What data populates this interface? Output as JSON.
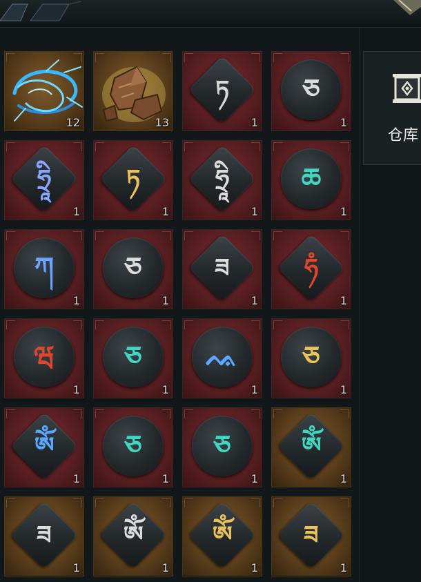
{
  "side_panel": {
    "label": "仓库",
    "icon": "storage-chest-icon"
  },
  "inventory": {
    "slots": [
      {
        "item": "lightning-essence-icon",
        "qty": "12",
        "frame": "gold",
        "kind": "illus"
      },
      {
        "item": "ore-rock-icon",
        "qty": "13",
        "frame": "gold",
        "kind": "illus"
      },
      {
        "item": "rune-diamond-icon",
        "glyph": "ཏ",
        "glyph_color": "#d8d8d8",
        "qty": "1",
        "frame": "red",
        "kind": "diamond"
      },
      {
        "item": "rune-circle-icon",
        "glyph": "ཅ",
        "glyph_color": "#dcdcdc",
        "qty": "1",
        "frame": "red",
        "kind": "circle"
      },
      {
        "item": "rune-diamond-icon",
        "glyph": "ཧྲཱི",
        "glyph_color": "#8aa6ff",
        "qty": "1",
        "frame": "red",
        "kind": "diamond"
      },
      {
        "item": "rune-diamond-icon",
        "glyph": "ཏ",
        "glyph_color": "#e8c25a",
        "qty": "1",
        "frame": "red",
        "kind": "diamond"
      },
      {
        "item": "rune-diamond-icon",
        "glyph": "ཧྲཱི",
        "glyph_color": "#dcdcdc",
        "qty": "1",
        "frame": "red",
        "kind": "diamond"
      },
      {
        "item": "rune-circle-icon",
        "glyph": "ཆ",
        "glyph_color": "#3fd6c2",
        "qty": "1",
        "frame": "red",
        "kind": "circle"
      },
      {
        "item": "rune-circle-icon",
        "glyph": "ཀ",
        "glyph_color": "#6aa6ff",
        "qty": "1",
        "frame": "red",
        "kind": "circle"
      },
      {
        "item": "rune-circle-icon",
        "glyph": "ཅ",
        "glyph_color": "#dcdcdc",
        "qty": "1",
        "frame": "red",
        "kind": "circle"
      },
      {
        "item": "rune-diamond-icon",
        "glyph": "ཟ",
        "glyph_color": "#dcdcdc",
        "qty": "1",
        "frame": "red",
        "kind": "diamond"
      },
      {
        "item": "rune-diamond-icon",
        "glyph": "ཧཾ",
        "glyph_color": "#e0452e",
        "qty": "1",
        "frame": "red",
        "kind": "diamond"
      },
      {
        "item": "rune-circle-icon",
        "glyph": "ཝ",
        "glyph_color": "#e0452e",
        "qty": "1",
        "frame": "red",
        "kind": "circle"
      },
      {
        "item": "rune-circle-icon",
        "glyph": "ཅ",
        "glyph_color": "#3fd6c2",
        "qty": "1",
        "frame": "red",
        "kind": "circle"
      },
      {
        "item": "rune-circle-icon",
        "glyph": "ᨕ",
        "glyph_color": "#5aa8ff",
        "qty": "1",
        "frame": "red",
        "kind": "circle"
      },
      {
        "item": "rune-circle-icon",
        "glyph": "ཅ",
        "glyph_color": "#e8c25a",
        "qty": "1",
        "frame": "red",
        "kind": "circle"
      },
      {
        "item": "rune-diamond-icon",
        "glyph": "ཨོཾ",
        "glyph_color": "#5aa8ff",
        "qty": "1",
        "frame": "red",
        "kind": "diamond"
      },
      {
        "item": "rune-circle-icon",
        "glyph": "ཅ",
        "glyph_color": "#3fd6c2",
        "qty": "1",
        "frame": "red",
        "kind": "circle"
      },
      {
        "item": "rune-circle-icon",
        "glyph": "ཅ",
        "glyph_color": "#3fd6c2",
        "qty": "1",
        "frame": "red",
        "kind": "circle"
      },
      {
        "item": "rune-diamond-icon",
        "glyph": "ཨོཾ",
        "glyph_color": "#3fd6c2",
        "qty": "1",
        "frame": "gold",
        "kind": "diamond"
      },
      {
        "item": "rune-diamond-icon",
        "glyph": "ཟ",
        "glyph_color": "#dcdcdc",
        "qty": "1",
        "frame": "gold",
        "kind": "diamond"
      },
      {
        "item": "rune-diamond-icon",
        "glyph": "ཨོཾ",
        "glyph_color": "#dcdcdc",
        "qty": "1",
        "frame": "gold",
        "kind": "diamond"
      },
      {
        "item": "rune-diamond-icon",
        "glyph": "ཨོཾ",
        "glyph_color": "#e8c25a",
        "qty": "1",
        "frame": "gold",
        "kind": "diamond"
      },
      {
        "item": "rune-diamond-icon",
        "glyph": "ཟ",
        "glyph_color": "#e8c25a",
        "qty": "1",
        "frame": "gold",
        "kind": "diamond"
      }
    ]
  }
}
